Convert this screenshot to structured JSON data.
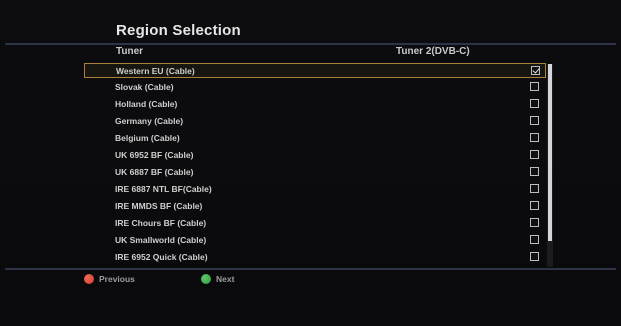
{
  "screen": {
    "title": "Region Selection"
  },
  "header": {
    "col_tuner": "Tuner",
    "col_tuner2": "Tuner 2(DVB-C)"
  },
  "regions": [
    {
      "label": "Western EU (Cable)",
      "checked": true,
      "selected": true
    },
    {
      "label": "Slovak (Cable)",
      "checked": false,
      "selected": false
    },
    {
      "label": "Holland (Cable)",
      "checked": false,
      "selected": false
    },
    {
      "label": "Germany (Cable)",
      "checked": false,
      "selected": false
    },
    {
      "label": "Belgium (Cable)",
      "checked": false,
      "selected": false
    },
    {
      "label": "UK 6952 BF (Cable)",
      "checked": false,
      "selected": false
    },
    {
      "label": "UK 6887 BF (Cable)",
      "checked": false,
      "selected": false
    },
    {
      "label": "IRE 6887 NTL BF(Cable)",
      "checked": false,
      "selected": false
    },
    {
      "label": "IRE MMDS BF (Cable)",
      "checked": false,
      "selected": false
    },
    {
      "label": "IRE Chours BF (Cable)",
      "checked": false,
      "selected": false
    },
    {
      "label": "UK Smallworld (Cable)",
      "checked": false,
      "selected": false
    },
    {
      "label": "IRE 6952 Quick (Cable)",
      "checked": false,
      "selected": false
    }
  ],
  "scrollbar": {
    "visible_fraction": 0.87
  },
  "footer": {
    "previous": {
      "label": "Previous",
      "color": "#d23a2a",
      "icon": "red-circle-icon"
    },
    "next": {
      "label": "Next",
      "color": "#2f9a3a",
      "icon": "green-circle-icon"
    }
  },
  "colors": {
    "selection_border": "#a9803e",
    "rule": "#2c3446",
    "background": "#0b0b0d"
  }
}
